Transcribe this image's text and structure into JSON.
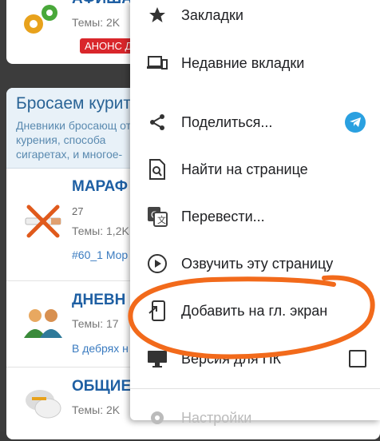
{
  "forum": {
    "top_card": {
      "title": "АФИША",
      "meta": "Темы: 2K",
      "badge": "АНОНС Д"
    },
    "section": {
      "title": "Бросаем курит",
      "description": "Дневники бросающ от курения, способа сигаретах, и многое-"
    },
    "rows": [
      {
        "title": "МАРАФ",
        "count": "27",
        "meta": "Темы: 1,2K",
        "link": "#60_1 Мор"
      },
      {
        "title": "ДНЕВН",
        "meta": "Темы: 17",
        "link": "В дебрях н"
      },
      {
        "title": "ОБЩИЕ",
        "meta": "Темы: 2K"
      }
    ]
  },
  "menu": {
    "items": [
      {
        "label": "Закладки",
        "icon": "star-icon"
      },
      {
        "label": "Недавние вкладки",
        "icon": "devices-icon"
      },
      {
        "label": "Поделиться...",
        "icon": "share-icon",
        "extra": "telegram-icon"
      },
      {
        "label": "Найти на странице",
        "icon": "find-in-page-icon"
      },
      {
        "label": "Перевести...",
        "icon": "translate-icon"
      },
      {
        "label": "Озвучить эту страницу",
        "icon": "play-circle-icon"
      },
      {
        "label": "Добавить на гл. экран",
        "icon": "add-to-home-icon"
      },
      {
        "label": "Версия для ПК",
        "icon": "desktop-icon",
        "checked": false
      },
      {
        "label": "Настройки",
        "icon": "settings-icon"
      }
    ]
  },
  "colors": {
    "highlight": "#f26a1b",
    "accent_link": "#1e5fa3",
    "badge": "#d9262b",
    "telegram": "#2aa0e0"
  }
}
